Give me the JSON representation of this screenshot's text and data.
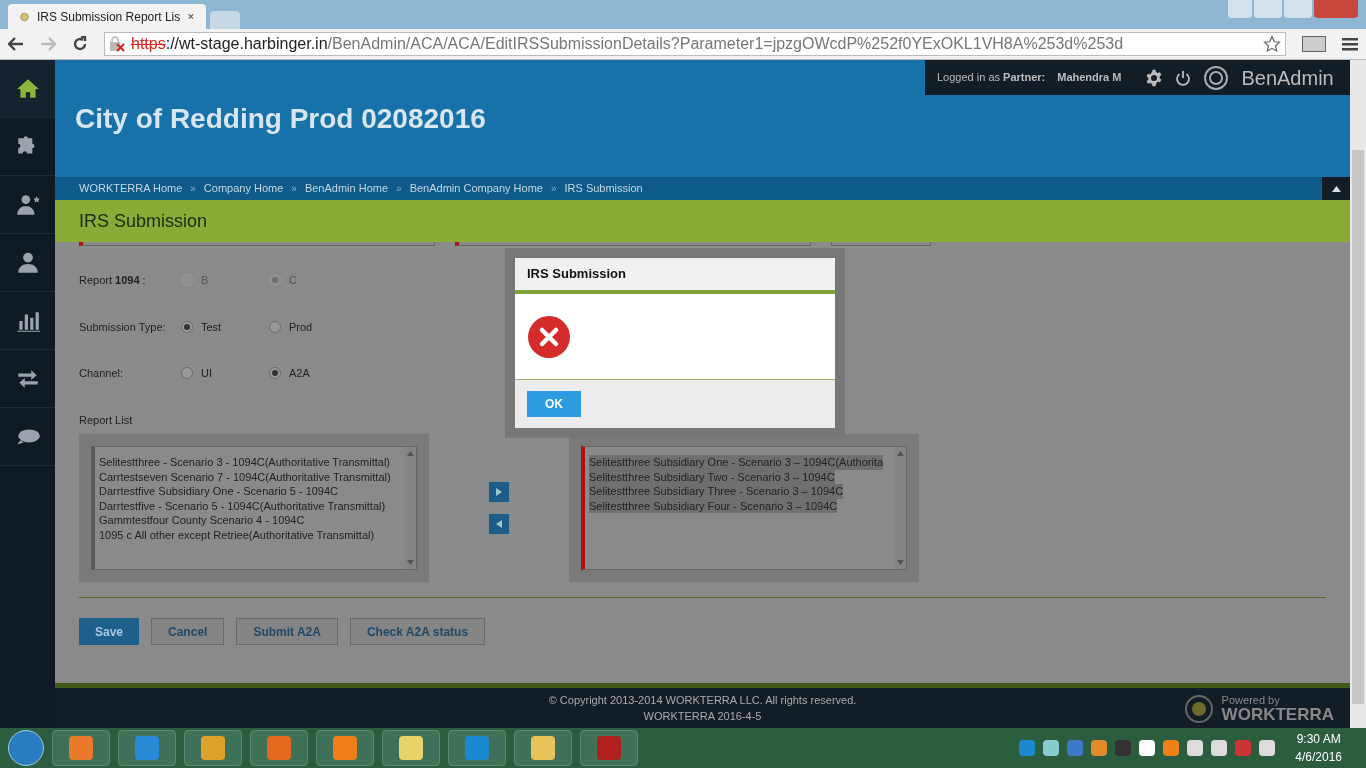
{
  "browser": {
    "tab_title": "IRS Submission Report Lis",
    "url": {
      "scheme": "https",
      "host": "://wt-stage.harbinger.in",
      "path": "/BenAdmin/ACA/ACA/EditIRSSubmissionDetails?Parameter1=jpzgOWcdP%252f0YExOKL1VH8A%253d%253d"
    }
  },
  "sidebar": {
    "items": [
      {
        "kind": "home",
        "selected": true
      },
      {
        "kind": "puzzle",
        "selected": false
      },
      {
        "kind": "user-star",
        "selected": false
      },
      {
        "kind": "user",
        "selected": false
      },
      {
        "kind": "chart",
        "selected": false
      },
      {
        "kind": "transfer",
        "selected": false
      },
      {
        "kind": "chat",
        "selected": false
      }
    ]
  },
  "header": {
    "logged_in_label": "Logged in as",
    "role": "Partner:",
    "user": "Mahendra M",
    "brand": "BenAdmin",
    "company_title": "City of Redding Prod 02082016"
  },
  "breadcrumb_separator": "»",
  "breadcrumbs": [
    "WORKTERRA Home",
    "Company Home",
    "BenAdmin Home",
    "BenAdmin Company Home",
    "IRS Submission"
  ],
  "page_title": "IRS Submission",
  "form": {
    "groups": [
      {
        "label": "Report **1094** :",
        "options": [
          {
            "label": "B",
            "selected": false,
            "disabled": true
          },
          {
            "label": "C",
            "selected": true,
            "disabled": true
          }
        ]
      },
      {
        "label": "Submission Type:",
        "options": [
          {
            "label": "Test",
            "selected": true,
            "disabled": false
          },
          {
            "label": "Prod",
            "selected": false,
            "disabled": false
          }
        ]
      },
      {
        "label": "Channel:",
        "options": [
          {
            "label": "UI",
            "selected": false,
            "disabled": false
          },
          {
            "label": "A2A",
            "selected": true,
            "disabled": false
          }
        ]
      }
    ],
    "report_list_label": "Report List",
    "available": [
      {
        "text": "Selitestthree - Scenario 3 - 1094C(Authoritative Transmittal)",
        "selected": false
      },
      {
        "text": "Carrtestseven Scenario 7 - 1094C(Authoritative Transmittal)",
        "selected": false
      },
      {
        "text": "Darrtestfive Subsidiary One - Scenario 5 - 1094C",
        "selected": false
      },
      {
        "text": "Darrtestfive - Scenario 5 - 1094C(Authoritative Transmittal)",
        "selected": false
      },
      {
        "text": "Gammtestfour County Scenario 4 - 1094C",
        "selected": false
      },
      {
        "text": "1095 c All other except Retriee(Authoritative Transmittal)",
        "selected": false
      }
    ],
    "chosen": [
      {
        "text": "Selitestthree Subsidiary One - Scenario 3 – 1094C(Authorita",
        "selected": true
      },
      {
        "text": "Selitestthree Subsidiary Two - Scenario 3 – 1094C",
        "selected": true
      },
      {
        "text": "Selitestthree Subsidiary Three - Scenario 3 – 1094C",
        "selected": true
      },
      {
        "text": "Selitestthree Subsidiary Four - Scenario 3 – 1094C",
        "selected": true
      }
    ],
    "buttons": [
      {
        "label": "Save",
        "kind": "primary"
      },
      {
        "label": "Cancel",
        "kind": "secondary"
      },
      {
        "label": "Submit A2A",
        "kind": "secondary"
      },
      {
        "label": "Check A2A status",
        "kind": "secondary"
      }
    ]
  },
  "dialog": {
    "title": "IRS Submission",
    "ok": "OK"
  },
  "footer": {
    "copyright": "© Copyright 2013-2014 WORKTERRA LLC. All rights reserved.",
    "version": "WORKTERRA 2016-4-5",
    "powered_by": "Powered by",
    "brand": "WORKTERRA"
  },
  "taskbar": {
    "time": "9:30 AM",
    "date": "4/6/2016"
  }
}
